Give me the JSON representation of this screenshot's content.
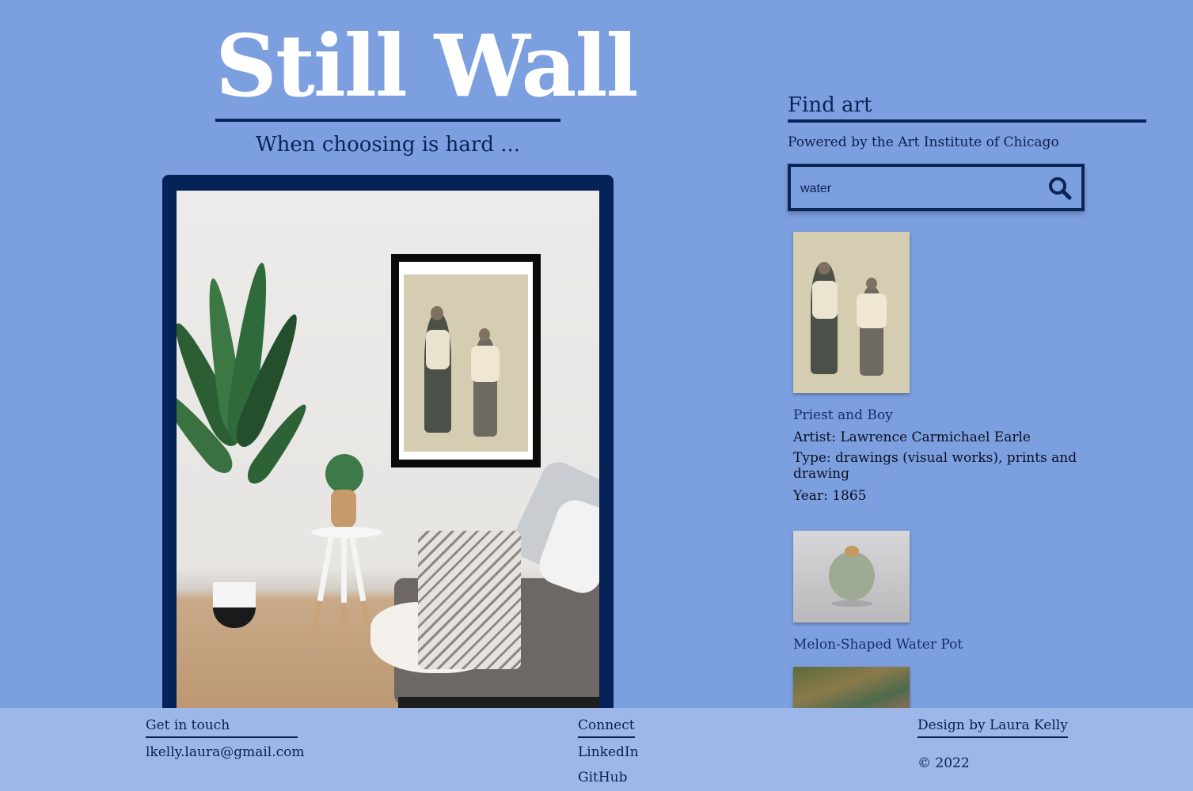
{
  "header": {
    "title": "Still Wall",
    "subtitle": "When choosing is hard ..."
  },
  "search_panel": {
    "heading": "Find art",
    "powered_by": "Powered by the Art Institute of Chicago",
    "search_value": "water",
    "search_icon": "search-icon"
  },
  "results": [
    {
      "title": "Priest and Boy",
      "artist": "Artist: Lawrence Carmichael Earle",
      "type": "Type: drawings (visual works), prints and drawing",
      "year": "Year: 1865"
    },
    {
      "title": "Melon-Shaped Water Pot"
    },
    {
      "title": ""
    }
  ],
  "footer": {
    "contact_heading": "Get in touch",
    "email": "lkelly.laura@gmail.com",
    "connect_heading": "Connect",
    "linkedin": "LinkedIn",
    "github": "GitHub",
    "design_credit": "Design by Laura Kelly",
    "copyright": "© 2022"
  },
  "colors": {
    "background": "#7c9fdf",
    "footer": "#9db8e8",
    "navy": "#0b2458",
    "title": "#ffffff"
  }
}
